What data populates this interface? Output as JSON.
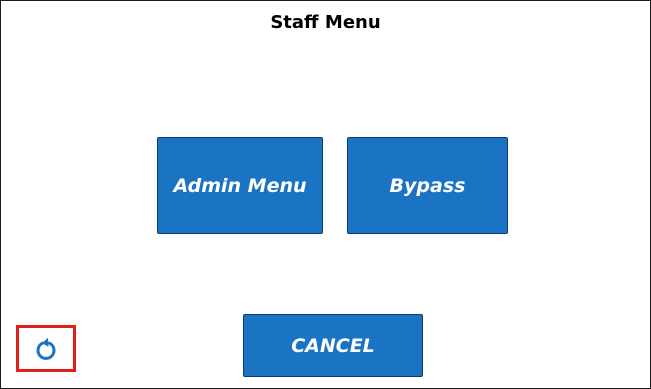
{
  "header": {
    "title": "Staff Menu"
  },
  "buttons": {
    "admin_menu": "Admin Menu",
    "bypass": "Bypass",
    "cancel": "CANCEL"
  },
  "icons": {
    "refresh": "refresh-icon"
  },
  "colors": {
    "button_fill": "#1b73c4",
    "button_border": "#0e3d6b",
    "button_text": "#ffffff",
    "icon_blue": "#1b73c4",
    "highlight_box": "#e0201b"
  }
}
